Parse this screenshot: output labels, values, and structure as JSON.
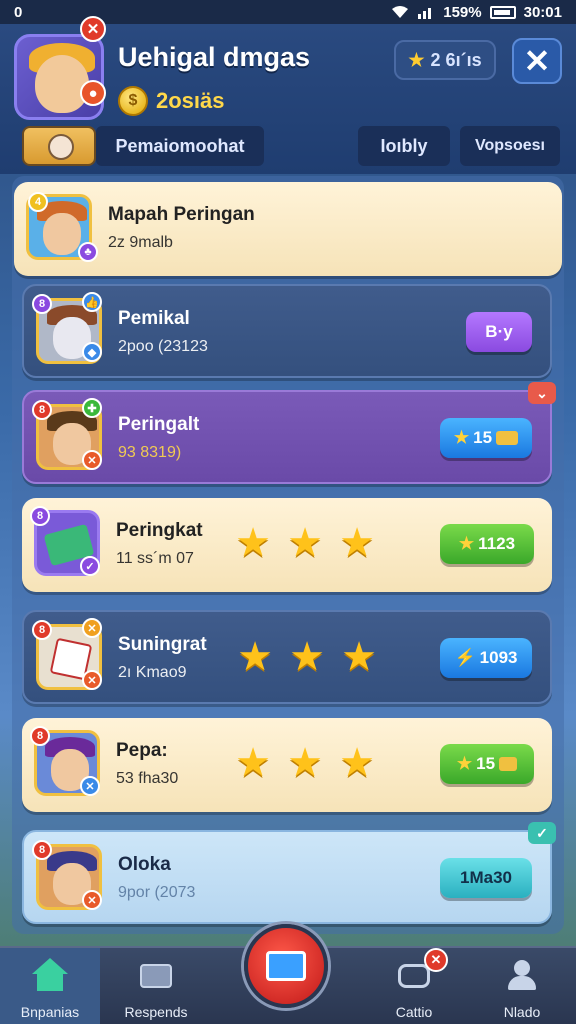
{
  "status_bar": {
    "left": "0",
    "battery_pct": "159%",
    "time": "30:01"
  },
  "header": {
    "title": "Uehigal dmgas",
    "coin_value": "2osıäs",
    "gems": "2 6ı´ıs",
    "close_label": "✕"
  },
  "tabs": [
    {
      "label": "Pemaiomoohat"
    },
    {
      "label": "Ioıbly"
    },
    {
      "label": "Vopsoesı"
    }
  ],
  "entries": [
    {
      "name": "Mapah Peringan",
      "sub": "2z 9malb",
      "action": "",
      "stars": 0,
      "style": "cream",
      "first": true
    },
    {
      "name": "Pemikal",
      "sub": "2poo (23123",
      "action": "B·y",
      "stars": 0,
      "style": "blue"
    },
    {
      "name": "Peringalt",
      "sub": "93 8319)",
      "action": "15",
      "stars": 0,
      "style": "purple",
      "corner": "⌄"
    },
    {
      "name": "Peringkat",
      "sub": "11 ss´m 07",
      "action": "1123",
      "stars": 3,
      "style": "cream"
    },
    {
      "name": "Suningrat",
      "sub": "2ı Kmao9",
      "action": "1093",
      "stars": 3,
      "style": "blue"
    },
    {
      "name": "Pepa:",
      "sub": "53 fha30",
      "action": "15",
      "stars": 3,
      "style": "cream"
    },
    {
      "name": "Oloka",
      "sub": "9por (2073",
      "action": "1Ma30",
      "stars": 0,
      "style": "light",
      "corner": "✓"
    }
  ],
  "bottom_nav": [
    {
      "label": "Bnpanias"
    },
    {
      "label": "Respends"
    },
    {
      "label": ""
    },
    {
      "label": "Cattio"
    },
    {
      "label": "Nlado"
    }
  ],
  "colors": {
    "accent_red": "#e03a2a",
    "coin_gold": "#ffd84a",
    "star_gold": "#ffc21a"
  }
}
